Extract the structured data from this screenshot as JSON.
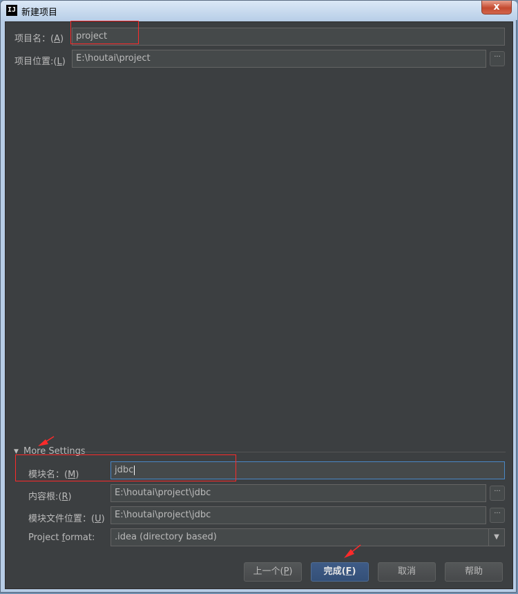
{
  "window": {
    "app_icon_text": "IJ",
    "title": "新建项目",
    "close_glyph": "x"
  },
  "form": {
    "project_name": {
      "label": "项目名：(A)",
      "label_pre": "项目名：(",
      "label_key": "A",
      "label_post": ")",
      "value": "project"
    },
    "project_location": {
      "label_pre": "项目位置:(",
      "label_key": "L",
      "label_post": ")",
      "value": "E:\\houtai\\project",
      "browse_label": "···"
    }
  },
  "more_settings": {
    "header": "More Settings",
    "module_name": {
      "label_pre": "模块名：(",
      "label_key": "M",
      "label_post": ")",
      "value": "jdbc"
    },
    "content_root": {
      "label_pre": "内容根:(",
      "label_key": "R",
      "label_post": ")",
      "value": "E:\\houtai\\project\\jdbc",
      "browse_label": "···"
    },
    "module_file_location": {
      "label_pre": "模块文件位置：(",
      "label_key": "U",
      "label_post": ")",
      "value": "E:\\houtai\\project\\jdbc",
      "browse_label": "···"
    },
    "project_format": {
      "label_pre": "Project ",
      "label_key": "f",
      "label_post": "ormat:",
      "value": ".idea (directory based)"
    }
  },
  "buttons": {
    "previous": {
      "pre": "上一个(",
      "key": "P",
      "post": ")"
    },
    "finish": {
      "pre": "完成(",
      "key": "F",
      "post": ")"
    },
    "cancel": "取消",
    "help": "帮助"
  },
  "colors": {
    "annotation": "#ff2a2a",
    "client_bg": "#3c3f41",
    "focus_border": "#4a88c7",
    "default_button": "#365880"
  }
}
